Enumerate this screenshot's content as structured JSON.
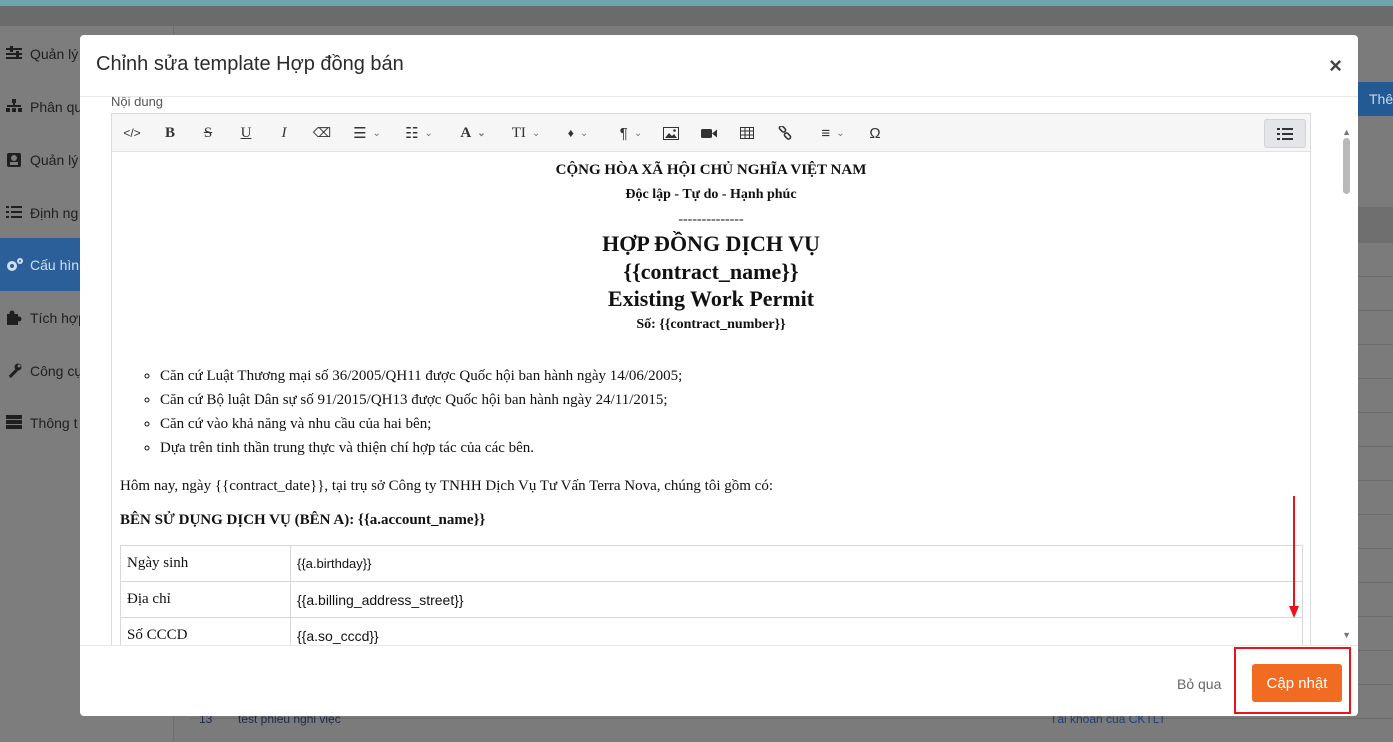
{
  "background": {
    "sidebar": [
      {
        "label": "Quản lý",
        "icon": "sliders-icon"
      },
      {
        "label": "Phân qu",
        "icon": "sitemap-icon"
      },
      {
        "label": "Quản lý",
        "icon": "user-card-icon"
      },
      {
        "label": "Định ng",
        "icon": "list-icon"
      },
      {
        "label": "Cấu hìn",
        "icon": "cogs-icon",
        "active": true
      },
      {
        "label": "Tích hợp",
        "icon": "puzzle-icon"
      },
      {
        "label": "Công cụ",
        "icon": "wrench-icon"
      },
      {
        "label": "Thông t",
        "icon": "server-icon"
      }
    ],
    "top_button": "Thê",
    "row_number": "13",
    "row_title": "test phiếu nghỉ việc",
    "row_link": "Tài khoản của CKTLT"
  },
  "modal": {
    "title": "Chỉnh sửa template Hợp đồng bán",
    "close": "×",
    "field_label": "Nội dung",
    "toolbar": [
      {
        "name": "code-view-icon",
        "glyph": "</>"
      },
      {
        "name": "bold-icon",
        "glyph": "B"
      },
      {
        "name": "strikethrough-icon",
        "glyph": "S"
      },
      {
        "name": "underline-icon",
        "glyph": "U"
      },
      {
        "name": "italic-icon",
        "glyph": "I"
      },
      {
        "name": "clear-format-icon",
        "glyph": "⌫"
      },
      {
        "name": "bullet-list-icon",
        "glyph": "☰"
      },
      {
        "name": "numbered-list-icon",
        "glyph": "☷"
      },
      {
        "name": "text-color-icon",
        "glyph": "A"
      },
      {
        "name": "font-size-icon",
        "glyph": "TI"
      },
      {
        "name": "fill-color-icon",
        "glyph": "♦"
      },
      {
        "name": "paragraph-icon",
        "glyph": "¶"
      },
      {
        "name": "image-icon",
        "glyph": "▣"
      },
      {
        "name": "video-icon",
        "glyph": "■"
      },
      {
        "name": "table-icon",
        "glyph": "▦"
      },
      {
        "name": "link-icon",
        "glyph": "∞"
      },
      {
        "name": "align-icon",
        "glyph": "≡"
      },
      {
        "name": "special-char-icon",
        "glyph": "Ω"
      }
    ],
    "document": {
      "line1": "CỘNG HÒA XÃ HỘI CHỦ NGHĨA VIỆT NAM",
      "line2": "Độc lập - Tự do - Hạnh phúc",
      "line3": "--------------",
      "line4": "HỢP ĐỒNG DỊCH VỤ",
      "line5": "{{contract_name}}",
      "line6": "Existing Work Permit",
      "line7": "Số: {{contract_number}}",
      "bullets": [
        "Căn cứ Luật Thương mại số 36/2005/QH11 được Quốc hội ban hành ngày  14/06/2005;",
        "Căn cứ Bộ luật Dân sự số 91/2015/QH13 được Quốc hội ban hành ngày 24/11/2015;",
        "Căn cứ vào khả năng và nhu cầu của hai bên;",
        "Dựa trên tinh thần trung thực và thiện chí hợp tác của các bên."
      ],
      "intro": "Hôm nay, ngày {{contract_date}}, tại trụ sở Công ty TNHH Dịch Vụ Tư Vấn Terra Nova, chúng tôi gồm có:",
      "party_a": "BÊN SỬ DỤNG DỊCH VỤ (BÊN A): {{a.account_name}}",
      "table": [
        {
          "key": "Ngày sinh",
          "value": "{{a.birthday}}"
        },
        {
          "key": "Địa chỉ",
          "value": "{{a.billing_address_street}}"
        },
        {
          "key": "Số CCCD",
          "value": "{{a.so_cccd}}"
        }
      ]
    },
    "footer": {
      "skip_label": "Bỏ qua",
      "update_label": "Cập nhật"
    }
  },
  "colors": {
    "primary_button": "#f26b23",
    "annotation": "#e8141a",
    "sidebar_active": "#2a5f9a"
  }
}
